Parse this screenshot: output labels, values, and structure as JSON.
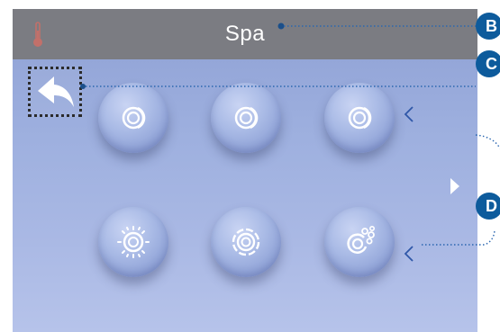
{
  "header": {
    "title": "Spa",
    "thermometer_icon": "thermometer-icon"
  },
  "navigation": {
    "back_icon": "back-arrow-icon",
    "next_icon": "right-arrow-icon"
  },
  "buttons": [
    {
      "icon": "jets-icon"
    },
    {
      "icon": "jets-icon"
    },
    {
      "icon": "jets-icon"
    },
    {
      "icon": "light-icon"
    },
    {
      "icon": "blower-icon"
    },
    {
      "icon": "bubbles-icon"
    }
  ],
  "callouts": {
    "b": "B",
    "c": "C",
    "d": "D"
  },
  "colors": {
    "header_bar": "#7b7c82",
    "screen_top": "#8ea0d4",
    "screen_bottom": "#b6c3ea",
    "callout": "#0d5b9c",
    "thermometer": "#c2706a"
  }
}
